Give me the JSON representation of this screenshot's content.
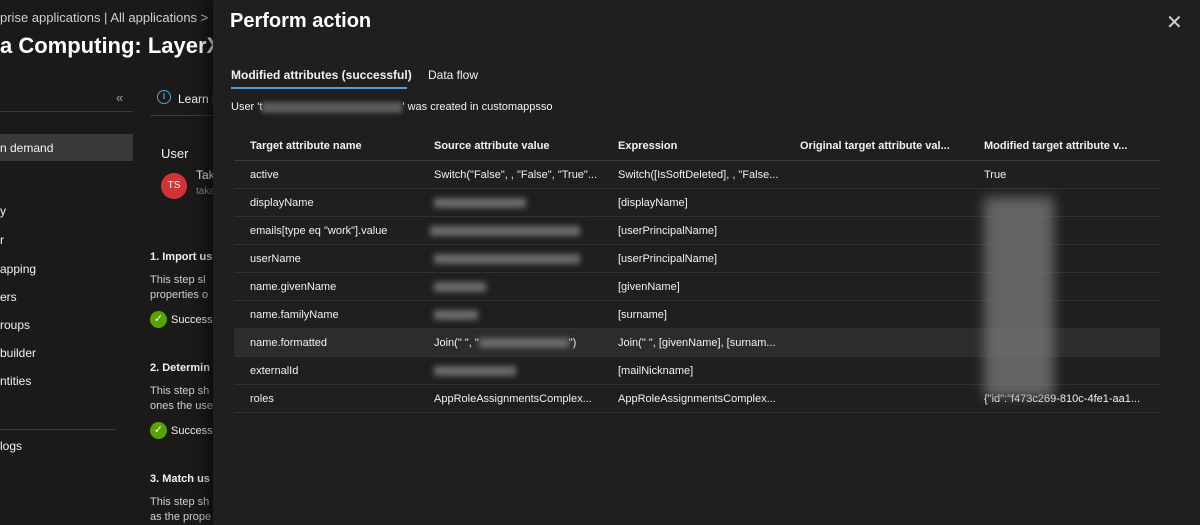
{
  "background": {
    "breadcrumb": "prise applications | All applications  >",
    "app_title": "a Computing: LayerX |",
    "collapse_icon": "chevron-double-left-icon",
    "sidebar": [
      {
        "label": "n demand",
        "active": true
      },
      {
        "label": "y",
        "active": false
      },
      {
        "label": "r",
        "active": false
      },
      {
        "label": "apping",
        "active": false
      },
      {
        "label": "ers",
        "active": false
      },
      {
        "label": "roups",
        "active": false
      },
      {
        "label": "builder",
        "active": false
      },
      {
        "label": "ntities",
        "active": false
      },
      {
        "label": "logs",
        "active": false
      }
    ],
    "learn_text": "Learn l",
    "user_label": "User",
    "avatar_initials": "TS",
    "user_name": "Tak",
    "user_sub": "taka",
    "steps": [
      {
        "title": "1. Import us",
        "text1": "This step sl",
        "text2": "properties o",
        "success": "Success"
      },
      {
        "title": "2. Determin",
        "text1": "This step sh",
        "text2": "ones the use",
        "success": "Success"
      },
      {
        "title": "3. Match us",
        "text1": "This step sh",
        "text2": "as the prope"
      }
    ]
  },
  "panel": {
    "title": "Perform action",
    "close_icon": "close-icon",
    "tabs": [
      {
        "label": "Modified attributes (successful)",
        "active": true
      },
      {
        "label": "Data flow",
        "active": false
      }
    ],
    "status_prefix": "User 't",
    "status_suffix": "' was created in customappsso",
    "columns": [
      "Target attribute name",
      "Source attribute value",
      "Expression",
      "Original target attribute val...",
      "Modified target attribute v..."
    ],
    "rows": [
      {
        "target": "active",
        "source": "Switch(\"False\", , \"False\", \"True\"...",
        "expression": "Switch([IsSoftDeleted], , \"False...",
        "original": "",
        "modified": "True"
      },
      {
        "target": "displayName",
        "source": "",
        "expression": "[displayName]",
        "original": "",
        "modified": ""
      },
      {
        "target": "emails[type eq \"work\"].value",
        "source": "",
        "expression": "[userPrincipalName]",
        "original": "",
        "modified": ""
      },
      {
        "target": "userName",
        "source": "",
        "expression": "[userPrincipalName]",
        "original": "",
        "modified": ""
      },
      {
        "target": "name.givenName",
        "source": "",
        "expression": "[givenName]",
        "original": "",
        "modified": ""
      },
      {
        "target": "name.familyName",
        "source": "",
        "expression": "[surname]",
        "original": "",
        "modified": ""
      },
      {
        "target": "name.formatted",
        "source": "Join(\" \", \"",
        "expression": "Join(\" \", [givenName], [surnam...",
        "original": "",
        "modified": ""
      },
      {
        "target": "externalId",
        "source": "",
        "expression": "[mailNickname]",
        "original": "",
        "modified": ""
      },
      {
        "target": "roles",
        "source": "AppRoleAssignmentsComplex...",
        "expression": "AppRoleAssignmentsComplex...",
        "original": "",
        "modified": "{\"id\":\"f473c269-810c-4fe1-aa1..."
      }
    ],
    "colors": {
      "accent": "#4fa3e0",
      "success": "#57a300",
      "avatar": "#d13438"
    }
  }
}
